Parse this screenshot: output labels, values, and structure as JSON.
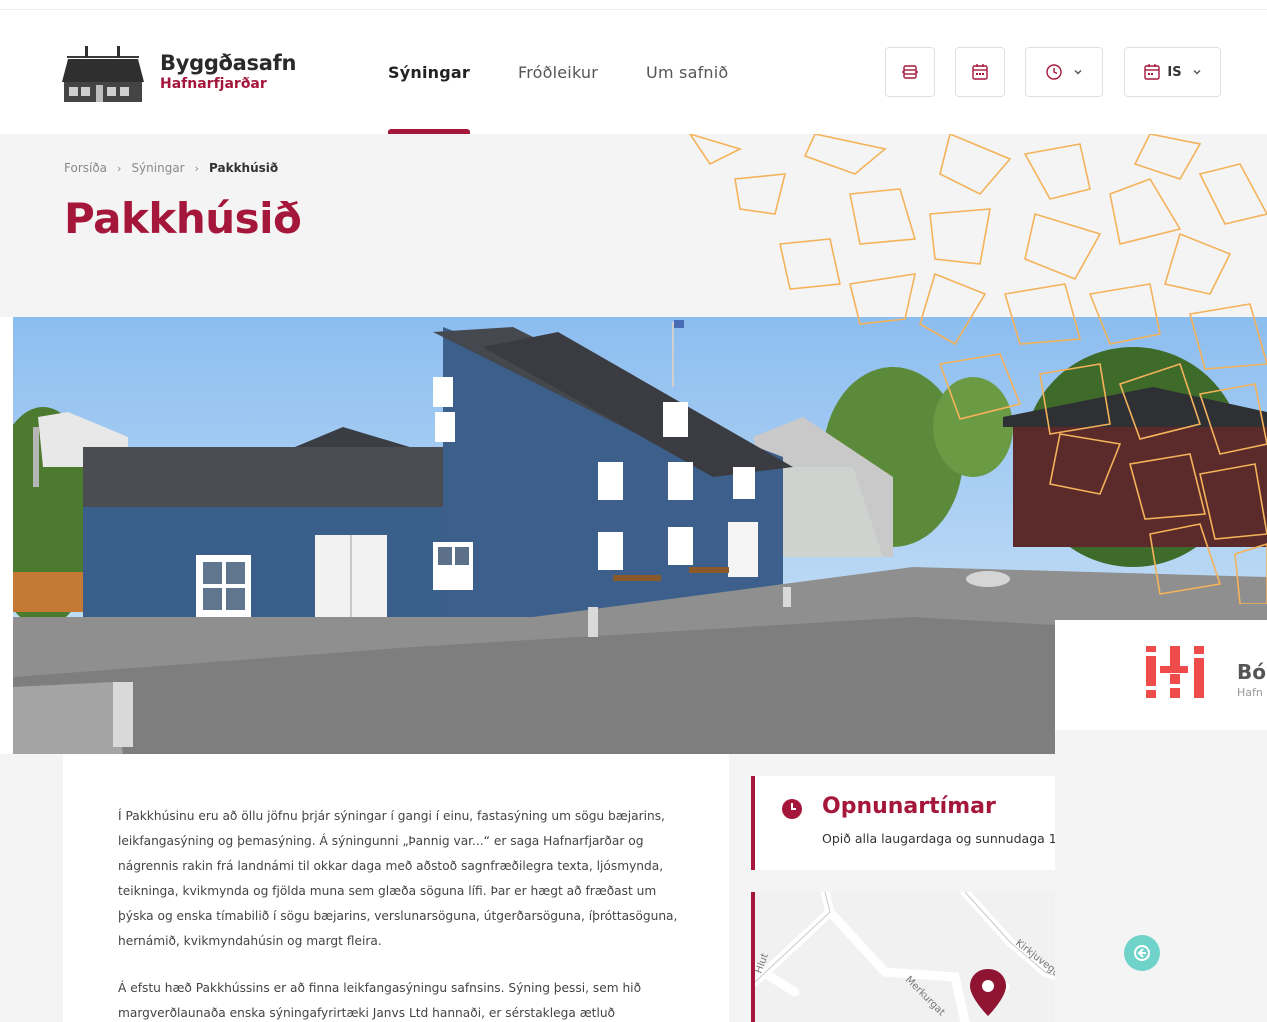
{
  "header": {
    "logo_title": "Byggðasafn",
    "logo_subtitle": "Hafnarfjarðar",
    "nav": [
      {
        "label": "Sýningar",
        "active": true
      },
      {
        "label": "Fróðleikur",
        "active": false
      },
      {
        "label": "Um safnið",
        "active": false
      }
    ],
    "buttons": {
      "icon1": "ticket-icon",
      "icon2": "calendar-icon",
      "icon3": "clock-icon",
      "language": "IS"
    }
  },
  "breadcrumb": {
    "home": "Forsíða",
    "section": "Sýningar",
    "current": "Pakkhúsið"
  },
  "page": {
    "title": "Pakkhúsið"
  },
  "article": {
    "paragraph1": "Í Pakkhúsinu eru að öllu jöfnu þrjár sýningar í gangi í einu, fastasýning um sögu bæjarins, leikfangasýning og þemasýning. Á sýningunni „Þannig var...“ er saga Hafnarfjarðar og nágrennis rakin frá landnámi til okkar daga með aðstoð sagnfræðilegra texta, ljósmynda, teikninga, kvikmynda og fjölda muna sem glæða söguna lífi. Þar er hægt að fræðast um þýska og enska tímabilið í sögu bæjarins, verslunarsöguna, útgerðarsöguna, íþróttasöguna, hernámið, kvikmyndahúsin og margt fleira.",
    "paragraph2": "Á efstu hæð Pakkhússins er að finna leikfangasýningu safnsins. Sýning þessi, sem hið margverðlaunaða enska sýningafyrirtæki Janvs Ltd hannaði, er sérstaklega ætluð"
  },
  "hours": {
    "title": "Opnunartímar",
    "text": "Opið alla laugardaga og sunnudaga 1"
  },
  "map": {
    "streets": [
      "Kirkjuvegu",
      "Merkurgat",
      "Hlut"
    ]
  },
  "overlay": {
    "title": "Bó",
    "subtitle": "Hafn"
  },
  "colors": {
    "brand": "#a5173a",
    "pattern": "#f4b25a",
    "teal": "#6fd3c9"
  }
}
